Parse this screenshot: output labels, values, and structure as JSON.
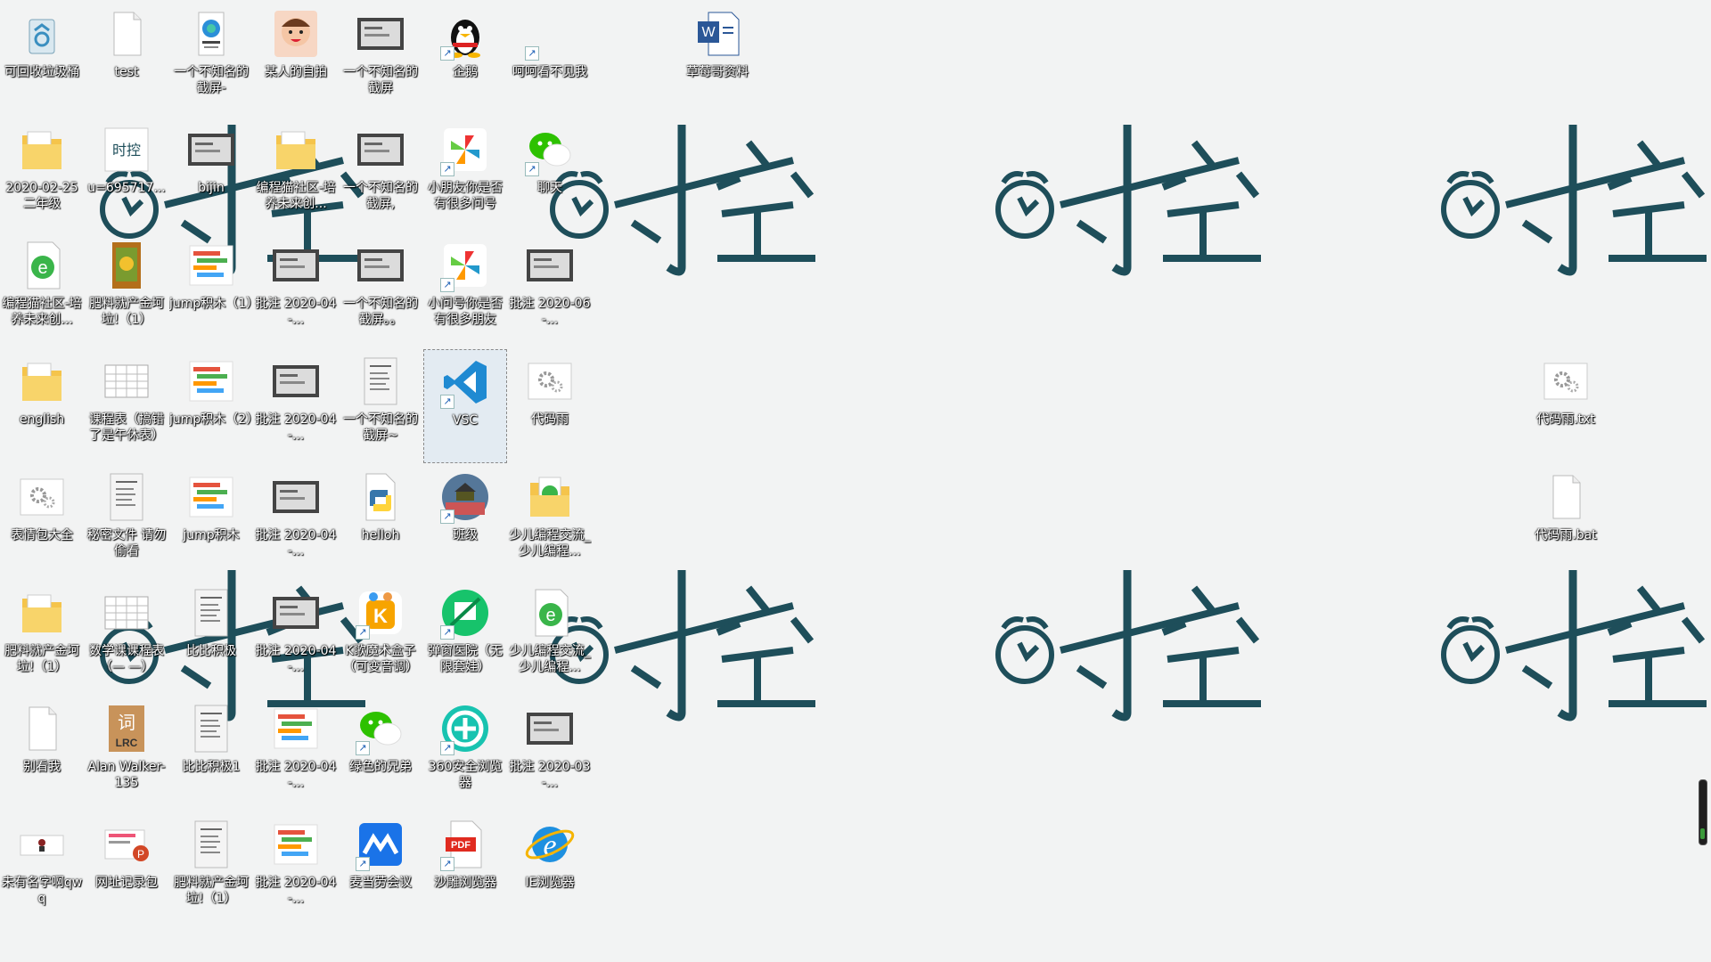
{
  "colors": {
    "wallpaper": "#f2f3f3",
    "logo": "#1e4e5a"
  },
  "wallpaper": {
    "brand_text": "时控"
  },
  "desktop_icons": [
    {
      "label": "可回收垃圾桶",
      "icon": "recycle-bin-icon",
      "shortcut": false
    },
    {
      "label": "test",
      "icon": "text-file-icon",
      "shortcut": false
    },
    {
      "label": "一个不知名的截屏-",
      "icon": "edge-icon",
      "shortcut": false
    },
    {
      "label": "某人的自拍",
      "icon": "cartoon-face-icon",
      "shortcut": false
    },
    {
      "label": "一个不知名的截屏",
      "icon": "screenshot-icon",
      "shortcut": false
    },
    {
      "label": "企鹅",
      "icon": "qq-penguin-icon",
      "shortcut": true
    },
    {
      "label": "呵呵看不见我",
      "icon": "blank-icon",
      "shortcut": true
    },
    {
      "label": "草莓哥资料",
      "icon": "word-doc-icon",
      "shortcut": false
    },
    {
      "label": "2020-02-25 二年级",
      "icon": "folder-icon",
      "shortcut": false
    },
    {
      "label": "u=695717...",
      "icon": "image-icon",
      "shortcut": false
    },
    {
      "label": "bijin",
      "icon": "screenshot-icon",
      "shortcut": false
    },
    {
      "label": "编程猫社区-培养未来创...",
      "icon": "folder-icon",
      "shortcut": false
    },
    {
      "label": "一个不知名的截屏,",
      "icon": "screenshot-icon",
      "shortcut": false
    },
    {
      "label": "小朋友你是否有很多问号",
      "icon": "pinwheel-icon",
      "shortcut": true
    },
    {
      "label": "聊天",
      "icon": "wechat-icon",
      "shortcut": true
    },
    {
      "label": "编程猫社区-培养未来创...",
      "icon": "ie-green-icon",
      "shortcut": false
    },
    {
      "label": "肥料就产金坷垃!（1）",
      "icon": "book-icon",
      "shortcut": false
    },
    {
      "label": "jump积木（1）",
      "icon": "code-blocks-icon",
      "shortcut": false
    },
    {
      "label": "批注 2020-04-...",
      "icon": "screenshot-icon",
      "shortcut": false
    },
    {
      "label": "一个不知名的截屏。。",
      "icon": "screenshot-icon",
      "shortcut": false
    },
    {
      "label": "小问号你是否有很多朋友",
      "icon": "pinwheel-icon",
      "shortcut": true
    },
    {
      "label": "批注 2020-06-...",
      "icon": "screenshot-icon",
      "shortcut": false
    },
    {
      "label": "english",
      "icon": "folder-icon",
      "shortcut": false
    },
    {
      "label": "课程表（搞错了是午休表）",
      "icon": "table-icon",
      "shortcut": false
    },
    {
      "label": "jump积木（2）",
      "icon": "code-blocks-icon",
      "shortcut": false
    },
    {
      "label": "批注 2020-04-...",
      "icon": "screenshot-icon",
      "shortcut": false
    },
    {
      "label": "一个不知名的截屏~",
      "icon": "doc-thumb-icon",
      "shortcut": false
    },
    {
      "label": "VSC",
      "icon": "vscode-icon",
      "shortcut": true
    },
    {
      "label": "代码雨",
      "icon": "settings-file-icon",
      "shortcut": false
    },
    {
      "label": "表情包大全",
      "icon": "settings-file-icon",
      "shortcut": false
    },
    {
      "label": "秘密文件 请勿偷看",
      "icon": "doc-thumb-icon",
      "shortcut": false
    },
    {
      "label": "jump积木",
      "icon": "code-blocks-icon",
      "shortcut": false
    },
    {
      "label": "批注 2020-04-...",
      "icon": "screenshot-icon",
      "shortcut": false
    },
    {
      "label": "helloh",
      "icon": "python-icon",
      "shortcut": false
    },
    {
      "label": "班级",
      "icon": "photo-icon",
      "shortcut": true
    },
    {
      "label": "少儿编程交流_少儿编程...",
      "icon": "folder-ie-icon",
      "shortcut": false
    },
    {
      "label": "肥料就产金坷垃!（1）",
      "icon": "folder-icon",
      "shortcut": false
    },
    {
      "label": "数学课课程表（— —）",
      "icon": "table-icon",
      "shortcut": false
    },
    {
      "label": "比比积极",
      "icon": "doc-thumb-icon",
      "shortcut": false
    },
    {
      "label": "批注 2020-04-...",
      "icon": "screenshot-icon",
      "shortcut": false
    },
    {
      "label": "K歌魔术盒子（可变音调）",
      "icon": "k-box-icon",
      "shortcut": true
    },
    {
      "label": "弹窗医院（无限套娃）",
      "icon": "green-circle-icon",
      "shortcut": true
    },
    {
      "label": "少儿编程交流_少儿编程...",
      "icon": "ie-green-icon",
      "shortcut": false
    },
    {
      "label": "别看我",
      "icon": "text-file-icon",
      "shortcut": false
    },
    {
      "label": "Alan Walker-135",
      "icon": "lrc-icon",
      "shortcut": false
    },
    {
      "label": "比比积极1",
      "icon": "doc-thumb-icon",
      "shortcut": false
    },
    {
      "label": "批注 2020-04-...",
      "icon": "code-blocks-icon",
      "shortcut": false
    },
    {
      "label": "绿色的兄弟",
      "icon": "wechat-icon",
      "shortcut": true
    },
    {
      "label": "360安全浏览器",
      "icon": "browser-360-icon",
      "shortcut": true
    },
    {
      "label": "批注 2020-03-...",
      "icon": "screenshot-icon",
      "shortcut": false
    },
    {
      "label": "未有名字啊qwq",
      "icon": "small-image-icon",
      "shortcut": false
    },
    {
      "label": "网址记录包",
      "icon": "ppt-icon",
      "shortcut": false
    },
    {
      "label": "肥料就产金坷垃!（1）",
      "icon": "doc-thumb-icon",
      "shortcut": false
    },
    {
      "label": "批注 2020-04-...",
      "icon": "code-blocks-icon",
      "shortcut": false
    },
    {
      "label": "麦当劳会议",
      "icon": "meeting-icon",
      "shortcut": true
    },
    {
      "label": "沙雕浏览器",
      "icon": "pdf-icon",
      "shortcut": true
    },
    {
      "label": "IE浏览器",
      "icon": "ie-icon",
      "shortcut": false
    },
    {
      "label": "代码雨.txt",
      "icon": "settings-file-icon",
      "shortcut": false
    },
    {
      "label": "代码雨.bat",
      "icon": "text-file-icon",
      "shortcut": false
    }
  ]
}
